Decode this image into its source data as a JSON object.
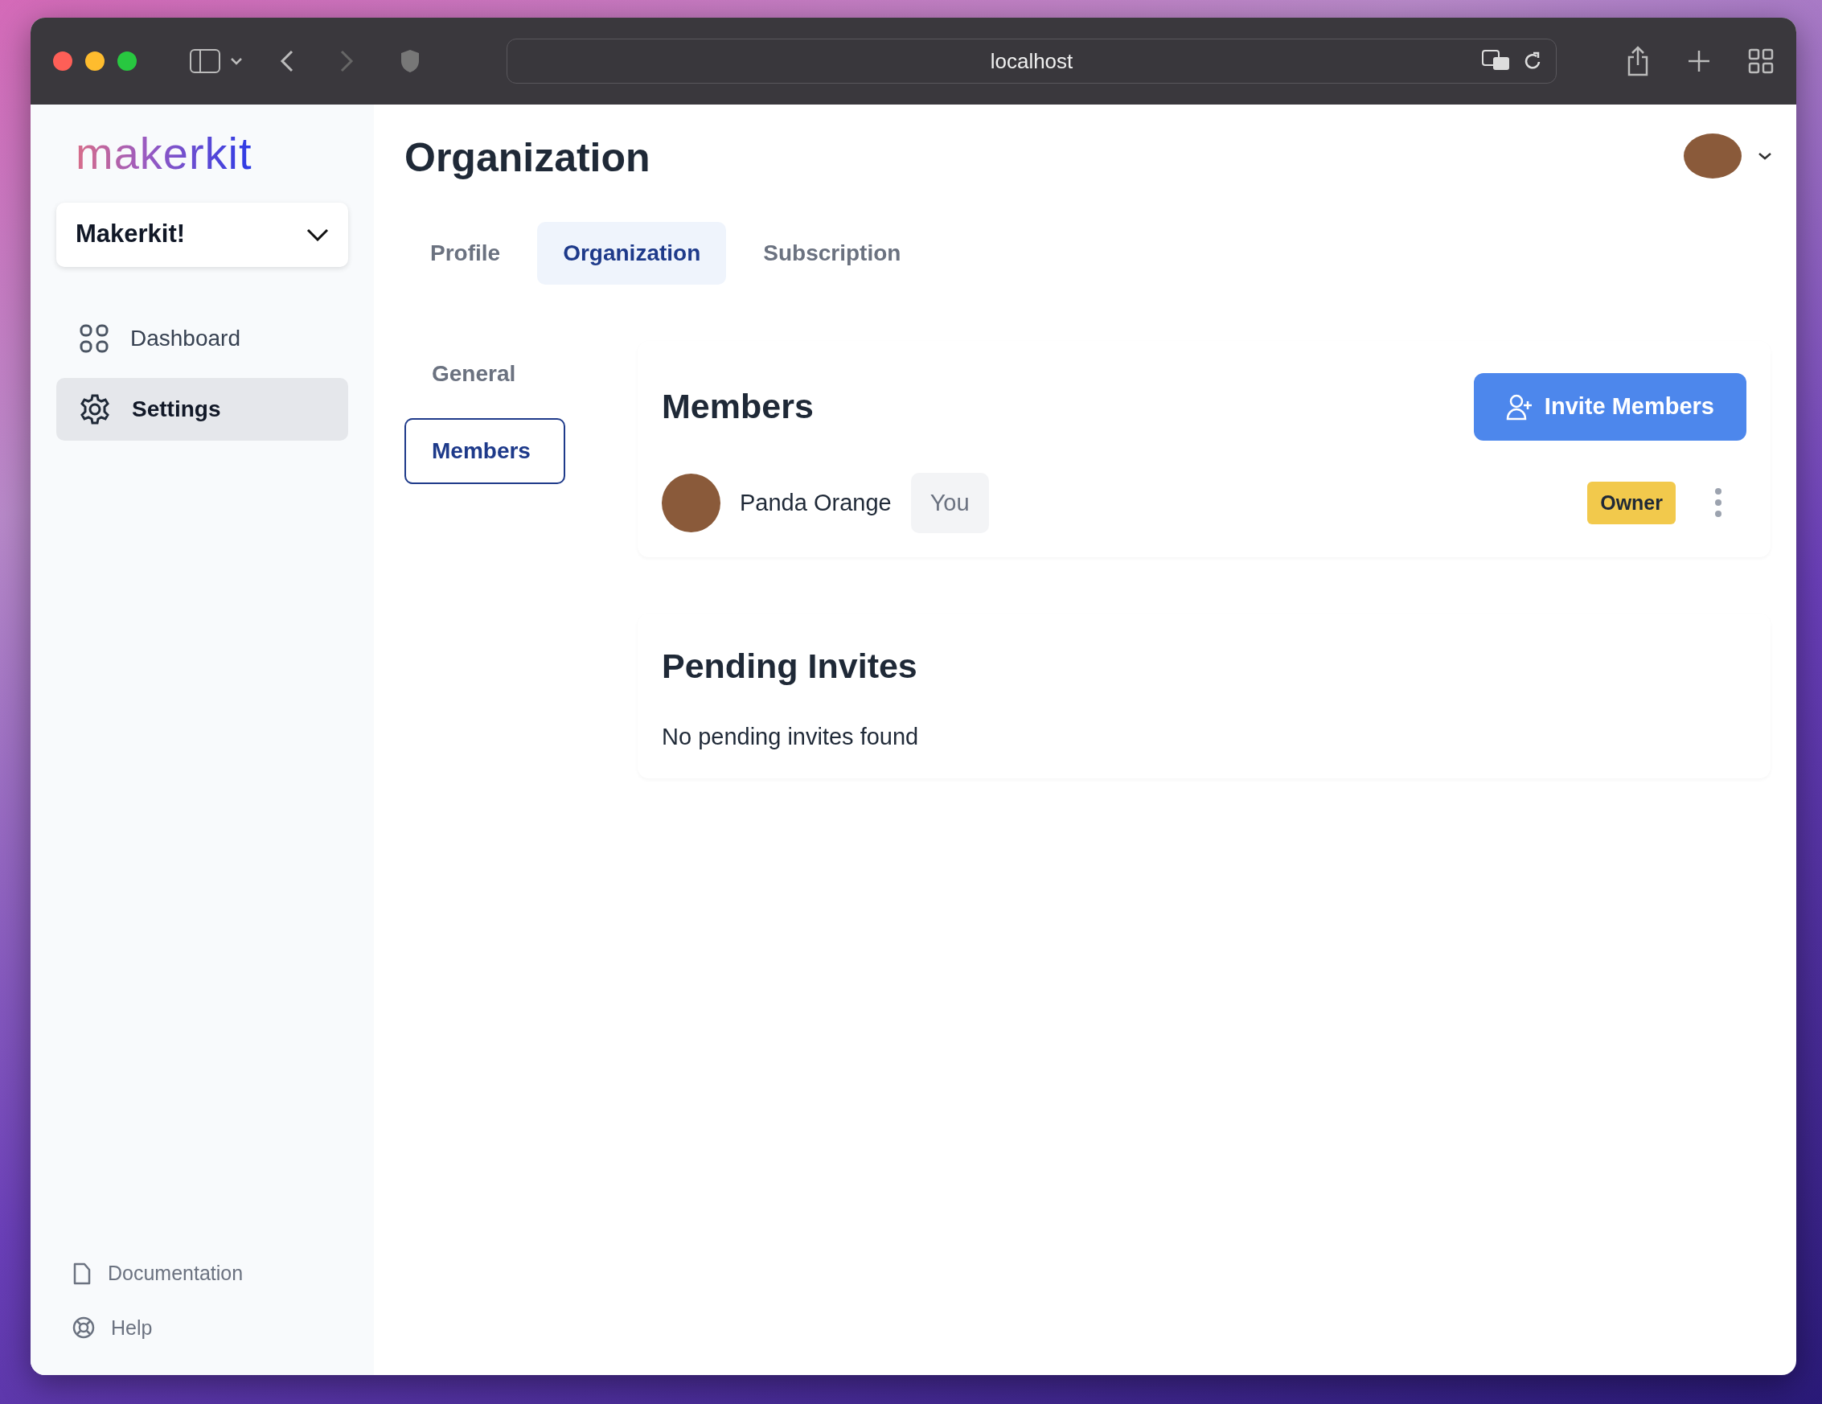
{
  "browser": {
    "address": "localhost"
  },
  "sidebar": {
    "logo": "makerkit",
    "organization": "Makerkit!",
    "nav": [
      {
        "label": "Dashboard",
        "selected": false
      },
      {
        "label": "Settings",
        "selected": true
      }
    ],
    "footer_links": [
      {
        "label": "Documentation"
      },
      {
        "label": "Help"
      }
    ]
  },
  "header": {
    "title": "Organization"
  },
  "tabs": [
    {
      "label": "Profile",
      "selected": false
    },
    {
      "label": "Organization",
      "selected": true
    },
    {
      "label": "Subscription",
      "selected": false
    }
  ],
  "subnav": [
    {
      "label": "General",
      "selected": false
    },
    {
      "label": "Members",
      "selected": true
    }
  ],
  "members_panel": {
    "title": "Members",
    "invite_button": "Invite Members",
    "members": [
      {
        "name": "Panda Orange",
        "you_label": "You",
        "role": "Owner"
      }
    ]
  },
  "pending_panel": {
    "title": "Pending Invites",
    "empty_text": "No pending invites found"
  }
}
